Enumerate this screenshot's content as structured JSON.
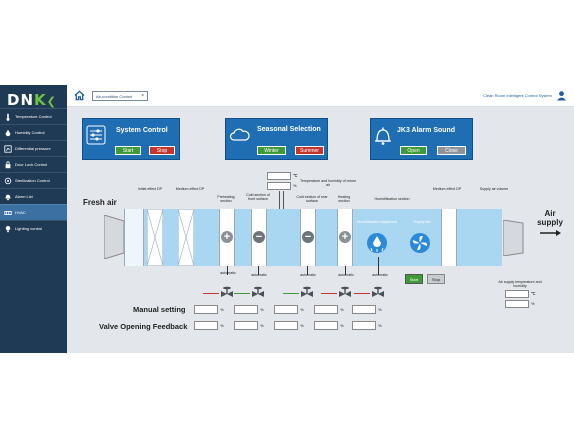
{
  "logo": {
    "text": "DN",
    "accent": "K"
  },
  "sidebar": {
    "items": [
      {
        "label": "Temperature Control",
        "icon": "thermometer-icon"
      },
      {
        "label": "Humidity Control",
        "icon": "droplet-icon"
      },
      {
        "label": "Differential pressure",
        "icon": "gauge-icon"
      },
      {
        "label": "Door Lock Control",
        "icon": "lock-icon"
      },
      {
        "label": "Sterilization Control",
        "icon": "uv-icon"
      },
      {
        "label": "Alarm List",
        "icon": "alarm-icon"
      },
      {
        "label": "HVAC",
        "icon": "hvac-icon",
        "active": true
      },
      {
        "label": "Lighting control",
        "icon": "bulb-icon"
      }
    ]
  },
  "topbar": {
    "tab_label": "Air-condition Control",
    "tab_close": "×",
    "system_title": "Clean Room Intelligent Control System"
  },
  "system_control": {
    "title": "System Control",
    "start": "Start",
    "stop": "Stop"
  },
  "seasonal": {
    "title": "Seasonal Selection",
    "winter": "Winter",
    "summer": "Summer"
  },
  "alarm": {
    "title": "JK3 Alarm Sound",
    "open": "Open",
    "close": "Close"
  },
  "units": {
    "celsius": "℃",
    "percent": "%"
  },
  "labels": {
    "fresh_air": "Fresh air",
    "air_supply": "Air supply",
    "initial_dp": "Initial effect DP",
    "medium_dp_left": "Medium effect DP",
    "preheating": "Preheating section",
    "cold_front": "Cold section of front surface",
    "return_air": "Temperature and humidity of return air",
    "cold_rear": "Cold section of rear surface",
    "heating": "Heating section",
    "humidification": "Humidification section",
    "medium_dp_right": "Medium effect DP",
    "supply_volume": "Supply air volume",
    "humid_equipment": "Humidification equipment",
    "supply_fan": "Supply fan",
    "supply_th": "Air supply temperature and humidity",
    "manual_setting": "Manual setting",
    "valve_feedback": "Valve Opening Feedback"
  },
  "valves": [
    "automatic",
    "automatic",
    "automatic",
    "automatic",
    "automatic"
  ],
  "fan": {
    "start": "Start",
    "stop": "Stop"
  },
  "colors": {
    "sidebar": "#1f3a55",
    "card": "#1f6eb4",
    "green": "#3f9a3a",
    "red": "#c43630",
    "duct": "#a9d6f1"
  }
}
